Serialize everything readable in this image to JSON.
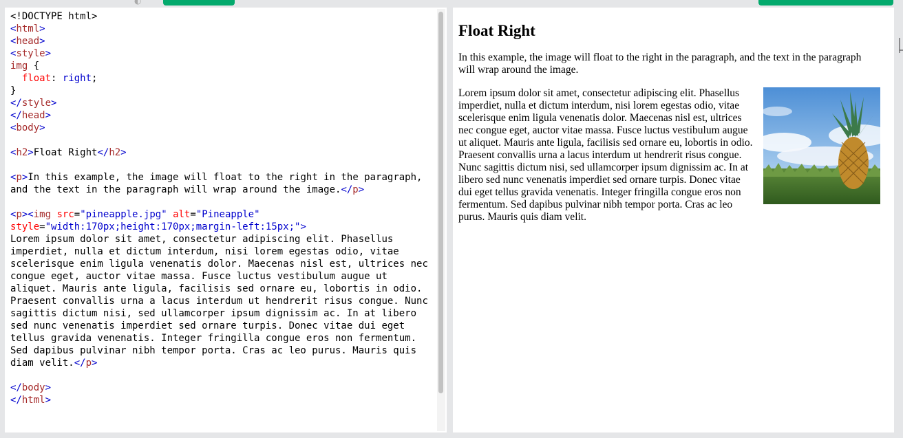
{
  "code": {
    "doctype": "<!DOCTYPE html>",
    "html_tag": "html",
    "head_tag": "head",
    "style_tag": "style",
    "css_selector": "img",
    "css_property": "float",
    "css_value": "right",
    "body_tag": "body",
    "h2_tag": "h2",
    "h2_text": "Float Right",
    "p_tag": "p",
    "p1_text": "In this example, the image will float to the right in the paragraph, and the text in the paragraph will wrap around the image.",
    "img_tag": "img",
    "img_src_attr": "src",
    "img_src_value": "\"pineapple.jpg\"",
    "img_alt_attr": "alt",
    "img_alt_value": "\"Pineapple\"",
    "img_style_attr": "style",
    "img_style_value": "\"width:170px;height:170px;margin-left:15px;\"",
    "p2_text": "Lorem ipsum dolor sit amet, consectetur adipiscing elit. Phasellus imperdiet, nulla et dictum interdum, nisi lorem egestas odio, vitae scelerisque enim ligula venenatis dolor. Maecenas nisl est, ultrices nec congue eget, auctor vitae massa. Fusce luctus vestibulum augue ut aliquet. Mauris ante ligula, facilisis sed ornare eu, lobortis in odio. Praesent convallis urna a lacus interdum ut hendrerit risus congue. Nunc sagittis dictum nisi, sed ullamcorper ipsum dignissim ac. In at libero sed nunc venenatis imperdiet sed ornare turpis. Donec vitae dui eget tellus gravida venenatis. Integer fringilla congue eros non fermentum. Sed dapibus pulvinar nibh tempor porta. Cras ac leo purus. Mauris quis diam velit."
  },
  "result": {
    "heading": "Float Right",
    "intro": "In this example, the image will float to the right in the paragraph, and the text in the paragraph will wrap around the image.",
    "image_alt": "Pineapple",
    "body": "Lorem ipsum dolor sit amet, consectetur adipiscing elit. Phasellus imperdiet, nulla et dictum interdum, nisi lorem egestas odio, vitae scelerisque enim ligula venenatis dolor. Maecenas nisl est, ultrices nec congue eget, auctor vitae massa. Fusce luctus vestibulum augue ut aliquet. Mauris ante ligula, facilisis sed ornare eu, lobortis in odio. Praesent convallis urna a lacus interdum ut hendrerit risus congue. Nunc sagittis dictum nisi, sed ullamcorper ipsum dignissim ac. In at libero sed nunc venenatis imperdiet sed ornare turpis. Donec vitae dui eget tellus gravida venenatis. Integer fringilla congue eros non fermentum. Sed dapibus pulvinar nibh tempor porta. Cras ac leo purus. Mauris quis diam velit."
  },
  "colors": {
    "accent": "#04aa6d",
    "tag": "#0000cd",
    "tag_name": "#a52a2a",
    "attribute": "#ff0000"
  }
}
